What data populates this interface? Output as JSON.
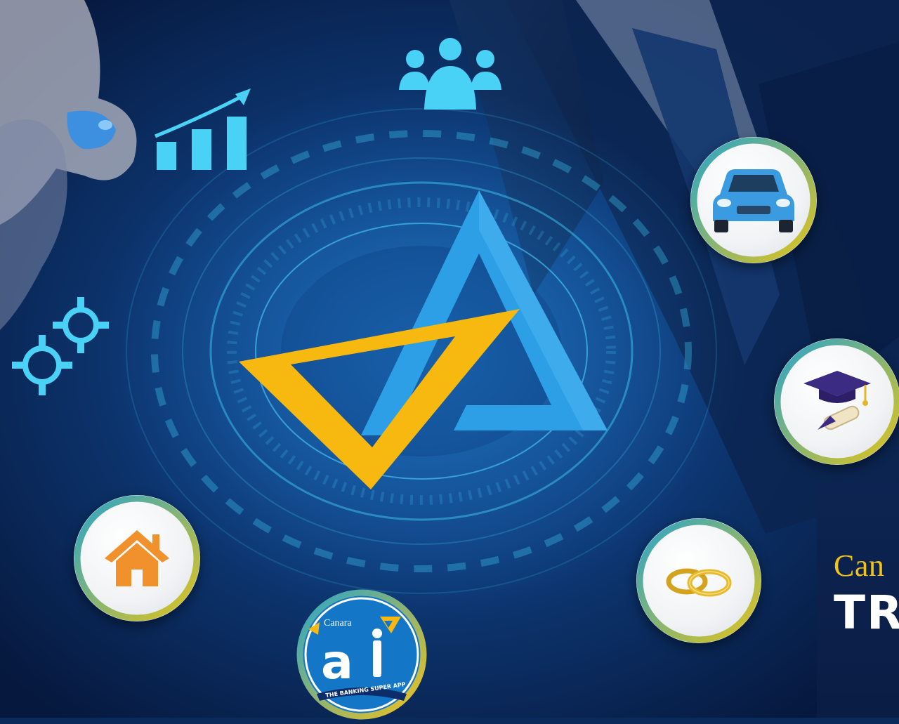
{
  "scene": {
    "colors": {
      "background_dark": "#06183d",
      "background_mid": "#0e3a78",
      "glow_cyan": "#3fc6f2",
      "logo_blue": "#2d9fe6",
      "logo_yellow": "#f7b80f",
      "ring_gold": "#d9c21a",
      "ring_teal": "#2aa5c9"
    }
  },
  "bubbles": [
    {
      "id": "car",
      "icon": "car-icon"
    },
    {
      "id": "education",
      "icon": "graduation-cap-icon"
    },
    {
      "id": "wedding",
      "icon": "rings-icon"
    },
    {
      "id": "home",
      "icon": "house-icon"
    }
  ],
  "hologram_icons": [
    "growth-chart-icon",
    "people-group-icon",
    "gears-icon"
  ],
  "app_badge": {
    "brand": "Canara",
    "name": "ai1",
    "tagline": "THE BANKING SUPER APP"
  },
  "promo": {
    "brand_partial": "Can",
    "title_partial": "TR"
  }
}
